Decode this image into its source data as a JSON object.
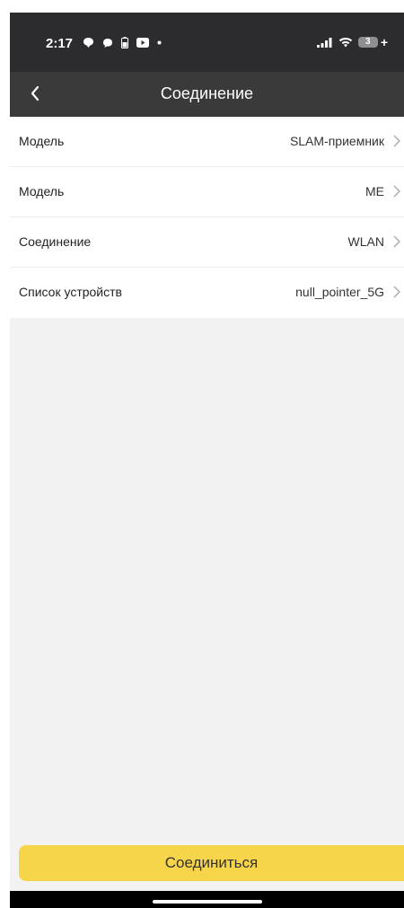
{
  "status_bar": {
    "time": "2:17",
    "left_icons": [
      "chat-bubble-icon",
      "message-icon",
      "battery-saver-icon",
      "youtube-icon",
      "dot-icon"
    ],
    "right_icons": [
      "cellular-signal-icon",
      "wifi-icon",
      "battery-icon"
    ],
    "battery_level": "3",
    "battery_suffix": "+"
  },
  "nav": {
    "title": "Соединение",
    "back_icon": "chevron-left-icon"
  },
  "settings": [
    {
      "label": "Модель",
      "value": "SLAM-приемник"
    },
    {
      "label": "Модель",
      "value": "ME"
    },
    {
      "label": "Соединение",
      "value": "WLAN"
    },
    {
      "label": "Список устройств",
      "value": "null_pointer_5G"
    }
  ],
  "connect_button": {
    "label": "Соединиться"
  },
  "colors": {
    "status_bar_bg": "#2c2c2e",
    "nav_bg": "#3a3a3a",
    "accent_button": "#f7d54a",
    "page_bg": "#f2f2f2"
  }
}
